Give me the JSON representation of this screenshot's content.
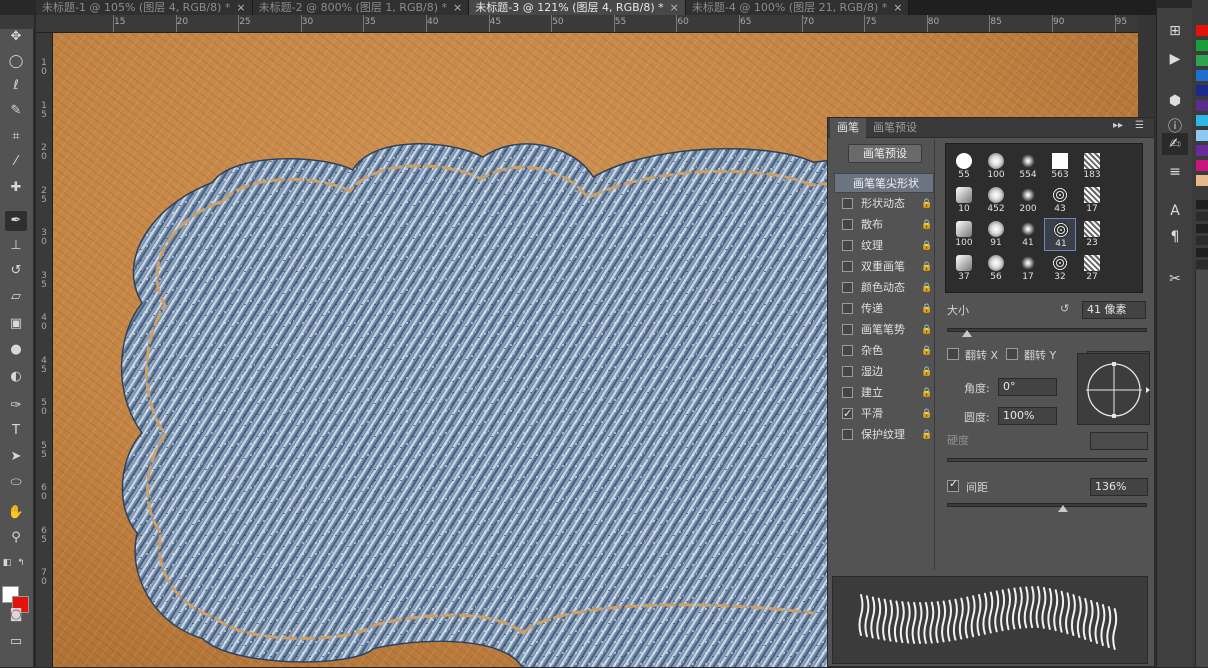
{
  "tabs": [
    {
      "label": "未标题-1 @ 105% (图层 4, RGB/8) *",
      "active": false
    },
    {
      "label": "未标题-2 @ 800% (图层 1, RGB/8) *",
      "active": false
    },
    {
      "label": "未标题-3 @ 121% (图层 4, RGB/8) *",
      "active": true
    },
    {
      "label": "未标题-4 @ 100% (图层 21, RGB/8) *",
      "active": false
    }
  ],
  "tab_close": "×",
  "ruler_top": [
    "15",
    "20",
    "25",
    "30",
    "35",
    "40",
    "45",
    "50",
    "55",
    "60",
    "65",
    "70",
    "75",
    "80",
    "85",
    "90",
    "95"
  ],
  "ruler_left": [
    "1\n0",
    "1\n5",
    "2\n0",
    "2\n5",
    "3\n0",
    "3\n5",
    "4\n0",
    "4\n5",
    "5\n0",
    "5\n5",
    "6\n0",
    "6\n5",
    "7\n0"
  ],
  "brush_panel": {
    "tab_brush": "画笔",
    "tab_presets": "画笔预设",
    "presets_button": "画笔预设",
    "tip_shape": "画笔笔尖形状",
    "options": [
      {
        "label": "形状动态",
        "checked": false
      },
      {
        "label": "散布",
        "checked": false
      },
      {
        "label": "纹理",
        "checked": false
      },
      {
        "label": "双重画笔",
        "checked": false
      },
      {
        "label": "颜色动态",
        "checked": false
      },
      {
        "label": "传递",
        "checked": false
      },
      {
        "label": "画笔笔势",
        "checked": false
      },
      {
        "label": "杂色",
        "checked": false
      },
      {
        "label": "湿边",
        "checked": false
      },
      {
        "label": "建立",
        "checked": false
      },
      {
        "label": "平滑",
        "checked": true
      },
      {
        "label": "保护纹理",
        "checked": false
      }
    ],
    "tips": [
      "55",
      "100",
      "554",
      "563",
      "183",
      "10",
      "452",
      "200",
      "43",
      "17",
      "100",
      "91",
      "41",
      "41",
      "23",
      "37",
      "56",
      "17",
      "32",
      "27"
    ],
    "selected_tip_index": 13,
    "size_label": "大小",
    "size_value": "41 像素",
    "size_fraction": 0.1,
    "flip_x": "翻转 X",
    "flip_y": "翻转 Y",
    "angle_label": "角度:",
    "angle_value": "0°",
    "roundness_label": "圆度:",
    "roundness_value": "100%",
    "hardness_label": "硬度",
    "spacing_label": "间距",
    "spacing_checked": true,
    "spacing_value": "136%",
    "spacing_fraction": 0.58
  },
  "colors": {
    "foreground": "#ffffff",
    "background": "#e3120b"
  },
  "swatches": [
    "#e3120b",
    "#1a9e37",
    "#2ea44f",
    "#1f6fd1",
    "#1b2a8a",
    "#5a2d8a",
    "#2db6e8",
    "#8fc8f0",
    "#6a2b9a",
    "#c7177d",
    "#e6b88a"
  ]
}
